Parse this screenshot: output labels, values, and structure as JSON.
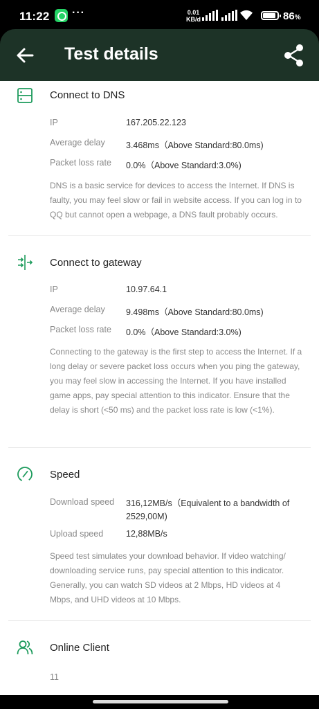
{
  "status_bar": {
    "time": "11:22",
    "net_speed_value": "0.01",
    "net_speed_unit": "KB/d",
    "battery_percent": "86"
  },
  "app_bar": {
    "title": "Test details",
    "back_icon": "arrow-left-icon",
    "share_icon": "share-icon"
  },
  "accent_color": "#1d9b5c",
  "sections": {
    "dns": {
      "title": "Connect to DNS",
      "icon": "server-icon",
      "rows": [
        {
          "label": "IP",
          "value": "167.205.22.123"
        },
        {
          "label": "Average delay",
          "value": "3.468ms（Above Standard:80.0ms)"
        },
        {
          "label": "Packet loss rate",
          "value": "0.0%（Above Standard:3.0%)"
        }
      ],
      "description": "DNS is a basic service for devices to access the Internet. If DNS is faulty, you may feel slow or fail in website access. If you can log in to QQ but cannot open a webpage, a DNS fault probably occurs."
    },
    "gateway": {
      "title": "Connect to gateway",
      "icon": "gateway-arrows-icon",
      "rows": [
        {
          "label": "IP",
          "value": "10.97.64.1"
        },
        {
          "label": "Average delay",
          "value": "9.498ms（Above Standard:80.0ms)"
        },
        {
          "label": "Packet loss rate",
          "value": "0.0%（Above Standard:3.0%)"
        }
      ],
      "description": "Connecting to the gateway is the first step to access the Internet. If a long delay or severe packet loss occurs when you ping the gateway, you may feel slow in accessing the Internet. If you have installed game apps, pay special attention to this indicator. Ensure that the delay is short (<50 ms) and the packet loss rate is low (<1%)."
    },
    "speed": {
      "title": "Speed",
      "icon": "speedometer-icon",
      "rows": [
        {
          "label": "Download speed",
          "value_line1": "316,12MB/s（Equivalent to a bandwidth of",
          "value_line2": "2529,00M)"
        },
        {
          "label": "Upload speed",
          "value": "12,88MB/s"
        }
      ],
      "description": "Speed test simulates your download behavior. If video watching/ downloading service runs, pay special attention to this indicator. Generally, you can watch SD videos at 2 Mbps, HD videos at 4 Mbps, and UHD videos at 10 Mbps."
    },
    "clients": {
      "title": "Online Client",
      "icon": "users-icon",
      "value": "11"
    }
  }
}
